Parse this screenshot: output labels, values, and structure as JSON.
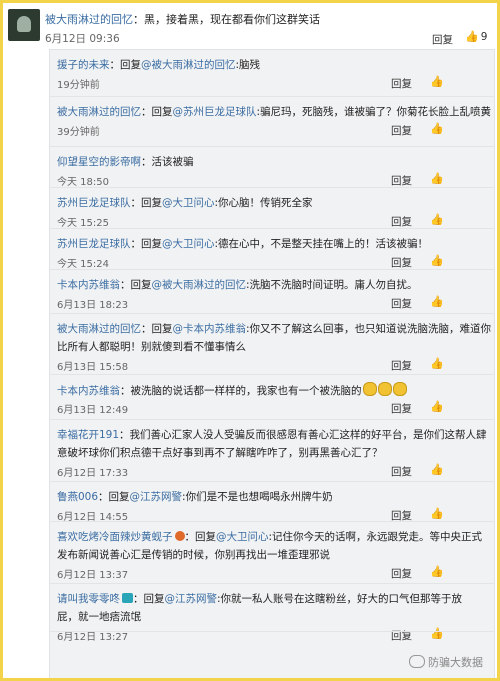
{
  "top_comment": {
    "user": "被大雨淋过的回忆",
    "text": "：黑，接着黑，现在都看你们这群笑话",
    "time": "6月12日 09:36",
    "reply_label": "回复",
    "like_count": "9"
  },
  "replies": [
    {
      "user": "援子的未来",
      "text": "：回复",
      "mention": "@被大雨淋过的回忆",
      "tail": ":脑残",
      "line2": "",
      "time": "19分钟前",
      "reply_label": "回复"
    },
    {
      "user": "被大雨淋过的回忆",
      "text": "：回复",
      "mention": "@苏州巨龙足球队",
      "tail": ":骗尼玛，死脑残，谁被骗了？你菊花长脸上乱喷黄",
      "line2": "",
      "time": "39分钟前",
      "reply_label": "回复"
    },
    {
      "user": "仰望星空的影帝啊",
      "text": "：活该被骗",
      "mention": "",
      "tail": "",
      "line2": "",
      "time": "今天 18:50",
      "reply_label": "回复"
    },
    {
      "user": "苏州巨龙足球队",
      "text": "：回复",
      "mention": "@大卫问心",
      "tail": ":你心脑！传销死全家",
      "line2": "",
      "time": "今天 15:25",
      "reply_label": "回复"
    },
    {
      "user": "苏州巨龙足球队",
      "text": "：回复",
      "mention": "@大卫问心",
      "tail": ":德在心中，不是整天挂在嘴上的！活该被骗！",
      "line2": "",
      "time": "今天 15:24",
      "reply_label": "回复"
    },
    {
      "user": "卡本内苏维翁",
      "text": "：回复",
      "mention": "@被大雨淋过的回忆",
      "tail": ":洗脑不洗脑时间证明。庸人勿自扰。",
      "line2": "",
      "time": "6月13日 18:23",
      "reply_label": "回复"
    },
    {
      "user": "被大雨淋过的回忆",
      "text": "：回复",
      "mention": "@卡本内苏维翁",
      "tail": ":你又不了解这么回事，也只知道说洗脑洗脑，难道你",
      "line2": "比所有人都聪明！别就傻到看不懂事情么",
      "time": "6月13日 15:58",
      "reply_label": "回复"
    },
    {
      "user": "卡本内苏维翁",
      "text": "：被洗脑的说话都一样样的，我家也有一个被洗脑的",
      "mention": "",
      "tail": "",
      "line2": "",
      "time": "6月13日 12:49",
      "reply_label": "回复"
    },
    {
      "user": "幸福花开191",
      "text": "：我们善心汇家人没人受骗反而很感恩有善心汇这样的好平台，是你们这帮人肆",
      "mention": "",
      "tail": "",
      "line2": "意破坏球你们积点德干点好事到再不了解瞎咋咋了，别再黑善心汇了？",
      "time": "6月12日 17:33",
      "reply_label": "回复"
    },
    {
      "user": "鲁燕006",
      "text": "：回复",
      "mention": "@江苏网警",
      "tail": ":你们是不是也想喝喝永州牌牛奶",
      "line2": "",
      "time": "6月12日 14:55",
      "reply_label": "回复"
    },
    {
      "user": "喜欢吃烤冷面辣炒黄蚬子",
      "text": "：回复",
      "mention": "@大卫问心",
      "tail": ":记住你今天的话啊，永远跟党走。等中央正式",
      "line2": "发布新闻说善心汇是传销的时候，你别再找出一堆歪理邪说",
      "time": "6月12日 13:37",
      "reply_label": "回复"
    },
    {
      "user": "请叫我零零咚",
      "text": "：回复",
      "mention": "@江苏网警",
      "tail": ":你就一私人账号在这瞎粉丝，好大的口气但那等于放",
      "line2": "屁，就一地痞流氓",
      "time": "6月12日 13:27",
      "reply_label": "回复"
    }
  ],
  "watermark": "防骗大数据"
}
